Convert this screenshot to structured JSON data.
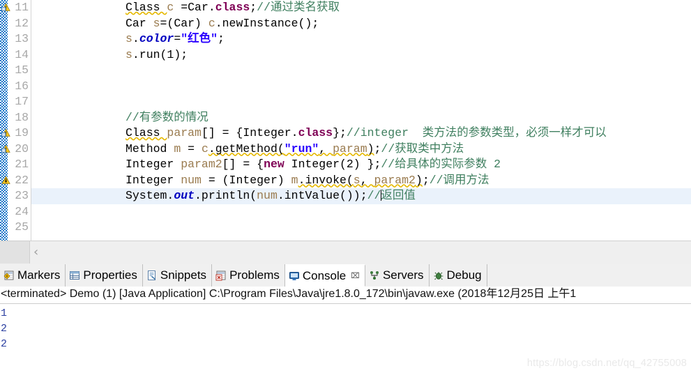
{
  "editor": {
    "lines": [
      {
        "num": "11",
        "marker": "warning",
        "current": false,
        "tokens": [
          {
            "t": "Class ",
            "c": "plain",
            "sq": true
          },
          {
            "t": "c ",
            "c": "local"
          },
          {
            "t": "=Car.",
            "c": "plain"
          },
          {
            "t": "class",
            "c": "kw"
          },
          {
            "t": ";",
            "c": "plain"
          },
          {
            "t": "//通过类名获取",
            "c": "cmt"
          }
        ]
      },
      {
        "num": "12",
        "marker": "",
        "current": false,
        "tokens": [
          {
            "t": "Car ",
            "c": "plain"
          },
          {
            "t": "s",
            "c": "local"
          },
          {
            "t": "=(Car) ",
            "c": "plain"
          },
          {
            "t": "c",
            "c": "local"
          },
          {
            "t": ".newInstance();",
            "c": "plain"
          }
        ]
      },
      {
        "num": "13",
        "marker": "",
        "current": false,
        "tokens": [
          {
            "t": "s",
            "c": "local"
          },
          {
            "t": ".",
            "c": "plain"
          },
          {
            "t": "color",
            "c": "field"
          },
          {
            "t": "=",
            "c": "plain"
          },
          {
            "t": "\"红色\"",
            "c": "str"
          },
          {
            "t": ";",
            "c": "plain"
          }
        ]
      },
      {
        "num": "14",
        "marker": "",
        "current": false,
        "tokens": [
          {
            "t": "s",
            "c": "local"
          },
          {
            "t": ".run(1);",
            "c": "plain"
          }
        ]
      },
      {
        "num": "15",
        "marker": "",
        "current": false,
        "tokens": []
      },
      {
        "num": "16",
        "marker": "",
        "current": false,
        "tokens": []
      },
      {
        "num": "17",
        "marker": "",
        "current": false,
        "tokens": []
      },
      {
        "num": "18",
        "marker": "",
        "current": false,
        "tokens": [
          {
            "t": "//有参数的情况",
            "c": "cmt"
          }
        ]
      },
      {
        "num": "19",
        "marker": "warning",
        "current": false,
        "tokens": [
          {
            "t": "Class ",
            "c": "plain",
            "sq": true
          },
          {
            "t": "param",
            "c": "local"
          },
          {
            "t": "[] = {Integer.",
            "c": "plain"
          },
          {
            "t": "class",
            "c": "kw"
          },
          {
            "t": "};",
            "c": "plain"
          },
          {
            "t": "//integer  类方法的参数类型，必须一样才可以",
            "c": "cmt"
          }
        ]
      },
      {
        "num": "20",
        "marker": "warning",
        "current": false,
        "tokens": [
          {
            "t": "Method ",
            "c": "plain"
          },
          {
            "t": "m",
            "c": "local"
          },
          {
            "t": " = ",
            "c": "plain"
          },
          {
            "t": "c",
            "c": "local"
          },
          {
            "t": ".getMethod(",
            "c": "plain",
            "sq": true
          },
          {
            "t": "\"run\"",
            "c": "str",
            "sq": true
          },
          {
            "t": ", ",
            "c": "plain",
            "sq": true
          },
          {
            "t": "param",
            "c": "local",
            "sq": true
          },
          {
            "t": ")",
            "c": "plain",
            "sq": true
          },
          {
            "t": ";",
            "c": "plain"
          },
          {
            "t": "//获取类中方法",
            "c": "cmt"
          }
        ]
      },
      {
        "num": "21",
        "marker": "",
        "current": false,
        "tokens": [
          {
            "t": "Integer ",
            "c": "plain"
          },
          {
            "t": "param2",
            "c": "local"
          },
          {
            "t": "[] = {",
            "c": "plain"
          },
          {
            "t": "new",
            "c": "kw"
          },
          {
            "t": " Integer(2) };",
            "c": "plain"
          },
          {
            "t": "//给具体的实际参数 2",
            "c": "cmt"
          }
        ]
      },
      {
        "num": "22",
        "marker": "warning-lock",
        "current": false,
        "tokens": [
          {
            "t": "Integer ",
            "c": "plain"
          },
          {
            "t": "num",
            "c": "local"
          },
          {
            "t": " = (Integer) ",
            "c": "plain"
          },
          {
            "t": "m",
            "c": "local"
          },
          {
            "t": ".invoke(",
            "c": "plain",
            "sq": true
          },
          {
            "t": "s",
            "c": "local",
            "sq": true
          },
          {
            "t": ", ",
            "c": "plain",
            "sq": true
          },
          {
            "t": "param2",
            "c": "local",
            "sq": true
          },
          {
            "t": ")",
            "c": "plain",
            "sq": true
          },
          {
            "t": ";",
            "c": "plain"
          },
          {
            "t": "//调用方法",
            "c": "cmt"
          }
        ]
      },
      {
        "num": "23",
        "marker": "",
        "current": true,
        "tokens": [
          {
            "t": "System.",
            "c": "plain"
          },
          {
            "t": "out",
            "c": "field"
          },
          {
            "t": ".println(",
            "c": "plain"
          },
          {
            "t": "num",
            "c": "local"
          },
          {
            "t": ".intValue());",
            "c": "plain"
          },
          {
            "t": "//",
            "c": "cmt"
          },
          {
            "t": "CARET",
            "c": "caret"
          },
          {
            "t": "返回值",
            "c": "cmt"
          }
        ]
      },
      {
        "num": "24",
        "marker": "",
        "current": false,
        "tokens": []
      },
      {
        "num": "25",
        "marker": "",
        "current": false,
        "tokens": []
      }
    ]
  },
  "tabs": [
    {
      "label": "Markers",
      "icon": "markers-icon",
      "active": false,
      "closable": false
    },
    {
      "label": "Properties",
      "icon": "properties-icon",
      "active": false,
      "closable": false
    },
    {
      "label": "Snippets",
      "icon": "snippets-icon",
      "active": false,
      "closable": false
    },
    {
      "label": "Problems",
      "icon": "problems-icon",
      "active": false,
      "closable": false
    },
    {
      "label": "Console",
      "icon": "console-icon",
      "active": true,
      "closable": true,
      "close_glyph": "⌧"
    },
    {
      "label": "Servers",
      "icon": "servers-icon",
      "active": false,
      "closable": false
    },
    {
      "label": "Debug",
      "icon": "debug-icon",
      "active": false,
      "closable": false
    }
  ],
  "console": {
    "header": "<terminated> Demo (1) [Java Application] C:\\Program Files\\Java\\jre1.8.0_172\\bin\\javaw.exe (2018年12月25日 上午1",
    "output": [
      "1",
      "2",
      "2"
    ]
  },
  "watermark": "https://blog.csdn.net/qq_42755008",
  "colors": {
    "changebar_blue": "#1473c8",
    "current_line": "#eaf2fb",
    "keyword": "#7f0055",
    "string": "#2a00ff",
    "comment": "#3f7f5f",
    "local_var": "#9a7b4f",
    "static_field": "#0000c0",
    "squiggle": "#e5b800",
    "console_text": "#2a3ea0"
  }
}
